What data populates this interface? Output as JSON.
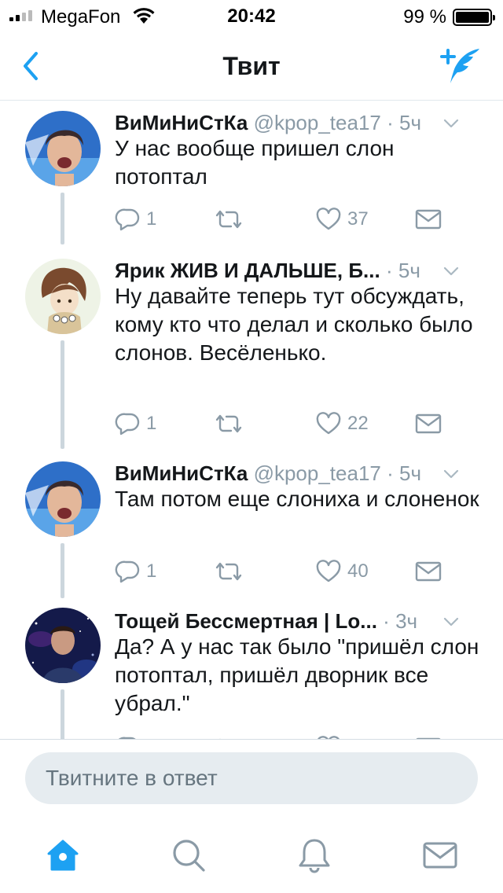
{
  "status_bar": {
    "carrier": "MegaFon",
    "time": "20:42",
    "battery": "99 %",
    "signal_icon": "signal-bars-icon",
    "wifi_icon": "wifi-icon",
    "battery_icon": "battery-icon"
  },
  "nav": {
    "title": "Твит",
    "back_icon": "chevron-left-icon",
    "compose_icon": "compose-tweet-icon"
  },
  "colors": {
    "accent": "#1da1f2",
    "text_primary": "#14171a",
    "text_secondary": "#8a9aa6",
    "thread_line": "#ccd6dd",
    "input_bg": "#e6ecf0"
  },
  "tweets": [
    {
      "author": "ВиМиНиСтКа",
      "handle": "@kpop_tea17",
      "separator": "·",
      "time": "5ч",
      "text": "У нас вообще пришел слон потоптал",
      "replies": "1",
      "retweets": "",
      "likes": "37"
    },
    {
      "author": "Ярик ЖИВ И ДАЛЬШЕ, Б...",
      "handle": "",
      "separator": "·",
      "time": "5ч",
      "text": "Ну давайте теперь тут обсуждать, кому кто что делал и сколько было слонов. Весёленько.",
      "replies": "1",
      "retweets": "",
      "likes": "22"
    },
    {
      "author": "ВиМиНиСтКа",
      "handle": "@kpop_tea17",
      "separator": "·",
      "time": "5ч",
      "text": "Там потом еще слониха и слоненок",
      "replies": "1",
      "retweets": "",
      "likes": "40"
    },
    {
      "author": "Тощей Бессмертная | Lo...",
      "handle": "",
      "separator": "·",
      "time": "3ч",
      "text": "Да? А у нас так было \"пришёл слон потоптал, пришёл дворник все убрал.\"",
      "replies": "",
      "retweets": "",
      "likes": ""
    }
  ],
  "composer": {
    "placeholder": "Твитните в ответ"
  },
  "tab_bar": {
    "items": [
      "home-icon",
      "search-icon",
      "notifications-bell-icon",
      "messages-envelope-icon"
    ],
    "active": "home-icon"
  }
}
